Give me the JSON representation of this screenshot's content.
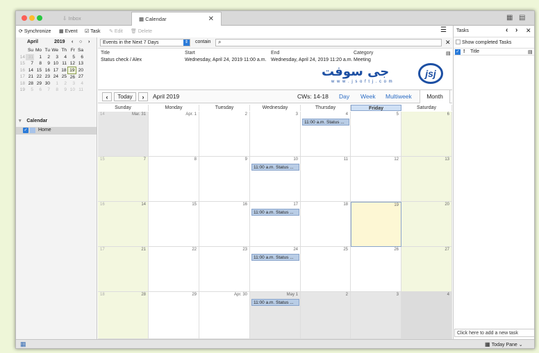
{
  "tabs": {
    "inbox": "Inbox",
    "calendar": "Calendar"
  },
  "toolbar": {
    "synchronize": "Synchronize",
    "event": "Event",
    "task": "Task",
    "edit": "Edit",
    "delete": "Delete"
  },
  "minical": {
    "month": "April",
    "year": "2019",
    "weekday_headers": [
      "Su",
      "Mo",
      "Tu",
      "We",
      "Th",
      "Fr",
      "Sa"
    ],
    "weeks": [
      {
        "wk": "14",
        "days": [
          "31",
          "1",
          "2",
          "3",
          "4",
          "5",
          "6"
        ]
      },
      {
        "wk": "15",
        "days": [
          "7",
          "8",
          "9",
          "10",
          "11",
          "12",
          "13"
        ]
      },
      {
        "wk": "16",
        "days": [
          "14",
          "15",
          "16",
          "17",
          "18",
          "19",
          "20"
        ]
      },
      {
        "wk": "17",
        "days": [
          "21",
          "22",
          "23",
          "24",
          "25",
          "26",
          "27"
        ]
      },
      {
        "wk": "18",
        "days": [
          "28",
          "29",
          "30",
          "1",
          "2",
          "3",
          "4"
        ]
      },
      {
        "wk": "19",
        "days": [
          "5",
          "6",
          "7",
          "8",
          "9",
          "10",
          "11"
        ]
      }
    ]
  },
  "calendars": {
    "header": "Calendar",
    "home": "Home"
  },
  "filter": {
    "select": "Events in the Next 7 Days",
    "contain": "contain"
  },
  "event_list": {
    "headers": {
      "title": "Title",
      "start": "Start",
      "end": "End",
      "category": "Category"
    },
    "row": {
      "title": "Status check / Alex",
      "start": "Wednesday, April 24, 2019 11:00 a.m.",
      "end": "Wednesday, April 24, 2019 11:20 a.m.",
      "category": "Meeting"
    }
  },
  "watermark": {
    "arabic": "جی سوفت",
    "url": "w w w . j s o f t j . c o m",
    "logo": "jsj"
  },
  "nav": {
    "today": "Today",
    "month_title": "April 2019",
    "cws": "CWs: 14-18",
    "views": [
      "Day",
      "Week",
      "Multiweek",
      "Month"
    ]
  },
  "weekdays": [
    "Sunday",
    "Monday",
    "Tuesday",
    "Wednesday",
    "Thursday",
    "Friday",
    "Saturday"
  ],
  "grid": [
    {
      "wk": "14",
      "days": [
        "Mar. 31",
        "Apr. 1",
        "2",
        "3",
        "4",
        "5",
        "6"
      ]
    },
    {
      "wk": "15",
      "days": [
        "7",
        "8",
        "9",
        "10",
        "11",
        "12",
        "13"
      ]
    },
    {
      "wk": "16",
      "days": [
        "14",
        "15",
        "16",
        "17",
        "18",
        "19",
        "20"
      ]
    },
    {
      "wk": "17",
      "days": [
        "21",
        "22",
        "23",
        "24",
        "25",
        "26",
        "27"
      ]
    },
    {
      "wk": "18",
      "days": [
        "28",
        "29",
        "Apr. 30",
        "May 1",
        "2",
        "3",
        "4"
      ]
    }
  ],
  "event_label": "11:00 a.m. Status ...",
  "tasks": {
    "title": "Tasks",
    "show_completed": "Show completed Tasks",
    "col_title": "Title",
    "add_new": "Click here to add a new task"
  },
  "status": {
    "today_pane": "Today Pane"
  }
}
